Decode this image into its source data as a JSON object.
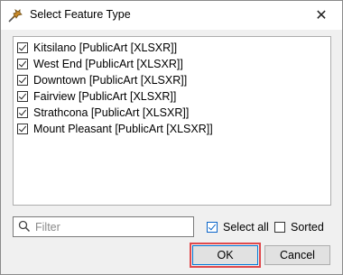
{
  "window": {
    "title": "Select Feature Type",
    "close_glyph": "✕",
    "app_icon": "fme-workbench-icon"
  },
  "feature_list": {
    "items": [
      {
        "label": "Kitsilano [PublicArt [XLSXR]]",
        "checked": true
      },
      {
        "label": "West End [PublicArt [XLSXR]]",
        "checked": true
      },
      {
        "label": "Downtown [PublicArt [XLSXR]]",
        "checked": true
      },
      {
        "label": "Fairview [PublicArt [XLSXR]]",
        "checked": true
      },
      {
        "label": "Strathcona [PublicArt [XLSXR]]",
        "checked": true
      },
      {
        "label": "Mount Pleasant [PublicArt [XLSXR]]",
        "checked": true
      }
    ]
  },
  "filter": {
    "placeholder": "Filter",
    "value": ""
  },
  "options": {
    "select_all_label": "Select all",
    "select_all_checked": true,
    "sorted_label": "Sorted",
    "sorted_checked": false
  },
  "buttons": {
    "ok_label": "OK",
    "cancel_label": "Cancel"
  },
  "colors": {
    "highlight": "#e0494c",
    "accent": "#0078d7"
  }
}
